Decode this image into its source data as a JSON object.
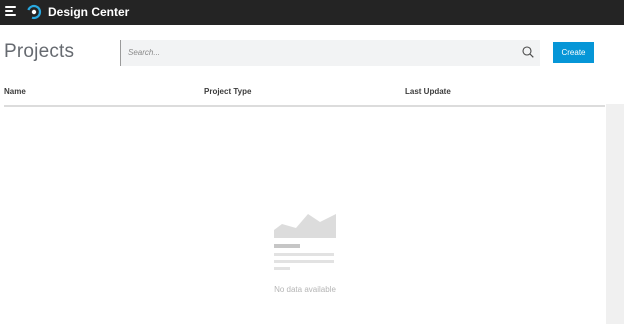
{
  "app": {
    "title": "Design Center"
  },
  "icons": {
    "menu": "menu-icon",
    "logo": "design-center-logo-icon",
    "search": "search-icon",
    "empty": "empty-chart-icon"
  },
  "page": {
    "title": "Projects"
  },
  "search": {
    "placeholder": "Search...",
    "value": ""
  },
  "toolbar": {
    "create_label": "Create"
  },
  "table": {
    "columns": [
      "Name",
      "Project Type",
      "Last Update"
    ],
    "rows": []
  },
  "empty_state": {
    "text": "No data available"
  },
  "colors": {
    "topbar": "#242424",
    "accent": "#0696d7",
    "logo_ring": "#29a8e0",
    "search_bg": "#f2f3f4",
    "empty_illustration": "#dcdcdc"
  }
}
